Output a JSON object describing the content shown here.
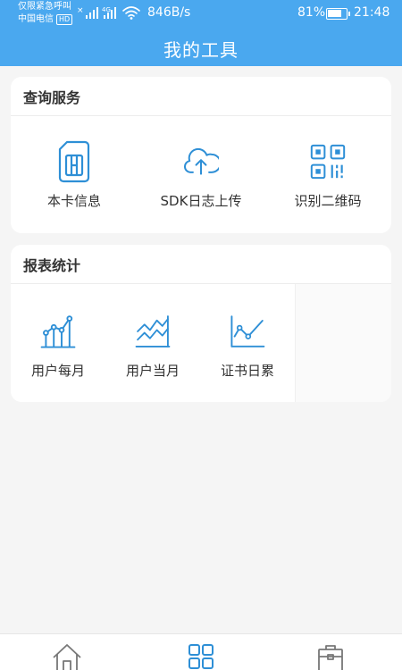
{
  "status_bar": {
    "carrier_line1": "仅限紧急呼叫",
    "carrier_line2": "中国电信",
    "hd_badge": "HD",
    "net_speed": "846B/s",
    "battery_percent": "81%",
    "battery_level": 0.81,
    "time": "21:48"
  },
  "header": {
    "title": "我的工具"
  },
  "sections": [
    {
      "title": "查询服务",
      "items": [
        {
          "label": "本卡信息",
          "icon": "sim-card-icon"
        },
        {
          "label": "SDK日志上传",
          "icon": "cloud-upload-icon"
        },
        {
          "label": "识别二维码",
          "icon": "qr-code-icon"
        }
      ]
    },
    {
      "title": "报表统计",
      "items": [
        {
          "label": "用户每月",
          "icon": "bar-line-chart-icon"
        },
        {
          "label": "用户当月",
          "icon": "zigzag-chart-icon"
        },
        {
          "label": "证书日累",
          "icon": "line-chart-icon"
        }
      ]
    }
  ],
  "tabbar": {
    "tabs": [
      {
        "name": "home",
        "icon": "home-icon"
      },
      {
        "name": "tools",
        "icon": "grid-icon"
      },
      {
        "name": "work",
        "icon": "briefcase-icon"
      }
    ]
  },
  "colors": {
    "accent": "#4aa8ef",
    "icon_blue": "#2e8fd6",
    "background": "#f5f5f5"
  }
}
